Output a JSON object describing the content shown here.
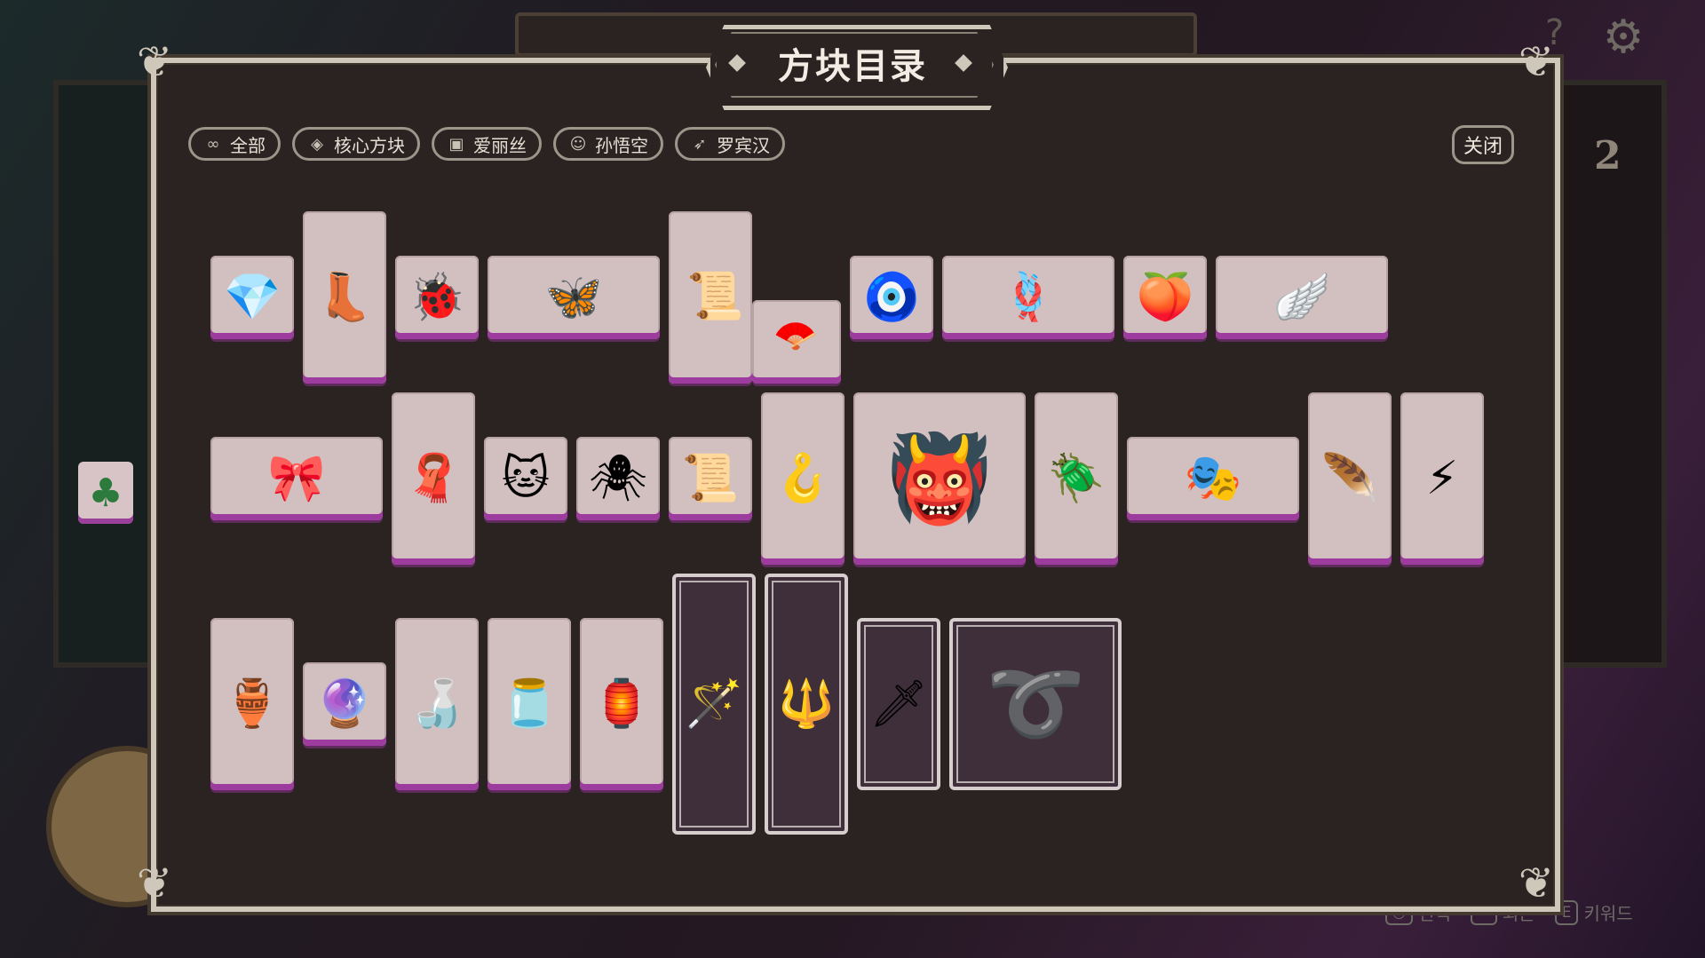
{
  "title": "方块目录",
  "filters": [
    {
      "label": "全部",
      "icon": "∞",
      "icon_name": "infinity-icon"
    },
    {
      "label": "核心方块",
      "icon": "◈",
      "icon_name": "core-block-icon"
    },
    {
      "label": "爱丽丝",
      "icon": "🂠",
      "icon_name": "cards-icon"
    },
    {
      "label": "孙悟空",
      "icon": "☺",
      "icon_name": "monkey-face-icon"
    },
    {
      "label": "罗宾汉",
      "icon": "➶",
      "icon_name": "bow-icon"
    }
  ],
  "close_label": "关闭",
  "side_counter": "2",
  "bottom_hints": [
    {
      "key": "◷",
      "label": "선택"
    },
    {
      "key": "←",
      "label": "외는"
    },
    {
      "key": "E",
      "label": "키워드"
    }
  ],
  "tiles": [
    {
      "name": "red-crystal-cushion",
      "glyph": "💎"
    },
    {
      "name": "tea-spout-boot",
      "glyph": "👢"
    },
    {
      "name": "ladybug-charm",
      "glyph": "🐞"
    },
    {
      "name": "winged-headdress",
      "glyph": "🦋"
    },
    {
      "name": "scroll-and-fan",
      "glyph": "📜"
    },
    {
      "name": "eye-disc",
      "glyph": "🧿"
    },
    {
      "name": "golden-rope",
      "glyph": "🪢"
    },
    {
      "name": "peach",
      "glyph": "🍑"
    },
    {
      "name": "golden-wings",
      "glyph": "🪽"
    },
    {
      "name": "orange-bow",
      "glyph": "🎀"
    },
    {
      "name": "purple-scarf",
      "glyph": "🧣"
    },
    {
      "name": "orange-cat",
      "glyph": "🐱"
    },
    {
      "name": "spider",
      "glyph": "🕷"
    },
    {
      "name": "paper-scroll",
      "glyph": "📜"
    },
    {
      "name": "hook-mask",
      "glyph": "🪝"
    },
    {
      "name": "demon-armor",
      "glyph": "👹"
    },
    {
      "name": "beetle-charm",
      "glyph": "🪲"
    },
    {
      "name": "masquerade-mask",
      "glyph": "🎭"
    },
    {
      "name": "feather-cloak",
      "glyph": "🪶"
    },
    {
      "name": "lightning-bottle",
      "glyph": "⚡"
    },
    {
      "name": "green-vase",
      "glyph": "🏺"
    },
    {
      "name": "small-orb",
      "glyph": "🔮"
    },
    {
      "name": "bonsai-bottle",
      "glyph": "🍶"
    },
    {
      "name": "purple-gourd",
      "glyph": "🫙"
    },
    {
      "name": "lantern-flask",
      "glyph": "🏮"
    },
    {
      "name": "golden-staff",
      "glyph": "🪄"
    },
    {
      "name": "jade-staff",
      "glyph": "🔱"
    },
    {
      "name": "short-sword",
      "glyph": "🗡"
    },
    {
      "name": "coiled-whip",
      "glyph": "➰"
    }
  ]
}
